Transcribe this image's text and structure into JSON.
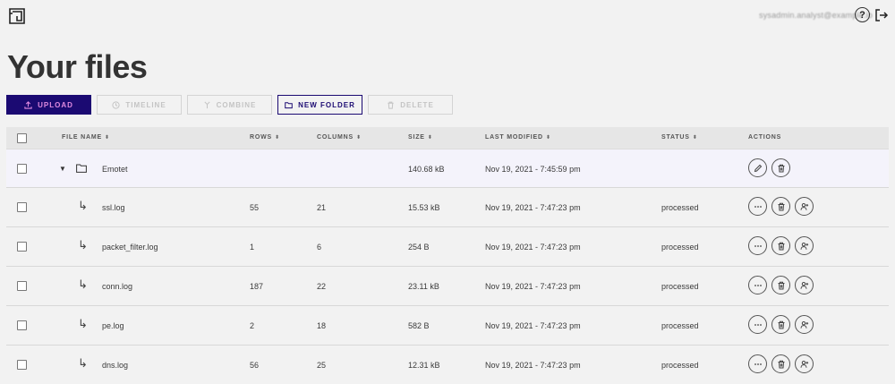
{
  "header": {
    "logo_icon": "app-logo-icon",
    "user_email": "sysadmin.analyst@example.io",
    "help_label": "?",
    "logout_icon": "logout-icon"
  },
  "page": {
    "title": "Your files"
  },
  "toolbar": {
    "upload": "UPLOAD",
    "timeline": "TIMELINE",
    "combine": "COMBINE",
    "new_folder": "NEW FOLDER",
    "delete": "DELETE"
  },
  "table": {
    "columns": {
      "file_name": "FILE NAME",
      "rows": "ROWS",
      "columns": "COLUMNS",
      "size": "SIZE",
      "last_modified": "LAST MODIFIED",
      "status": "STATUS",
      "actions": "ACTIONS"
    },
    "folder": {
      "name": "Emotet",
      "size": "140.68 kB",
      "modified": "Nov 19, 2021 - 7:45:59 pm"
    },
    "files": [
      {
        "name": "ssl.log",
        "rows": "55",
        "columns": "21",
        "size": "15.53 kB",
        "modified": "Nov 19, 2021 - 7:47:23 pm",
        "status": "processed"
      },
      {
        "name": "packet_filter.log",
        "rows": "1",
        "columns": "6",
        "size": "254 B",
        "modified": "Nov 19, 2021 - 7:47:23 pm",
        "status": "processed"
      },
      {
        "name": "conn.log",
        "rows": "187",
        "columns": "22",
        "size": "23.11 kB",
        "modified": "Nov 19, 2021 - 7:47:23 pm",
        "status": "processed"
      },
      {
        "name": "pe.log",
        "rows": "2",
        "columns": "18",
        "size": "582 B",
        "modified": "Nov 19, 2021 - 7:47:23 pm",
        "status": "processed"
      },
      {
        "name": "dns.log",
        "rows": "56",
        "columns": "25",
        "size": "12.31 kB",
        "modified": "Nov 19, 2021 - 7:47:23 pm",
        "status": "processed"
      }
    ],
    "child_arrow": "↳"
  },
  "colors": {
    "primary": "#1b0a72",
    "primary_text": "#e08ae0",
    "background": "#f2f2f2",
    "folder_row": "#f4f3fb"
  }
}
